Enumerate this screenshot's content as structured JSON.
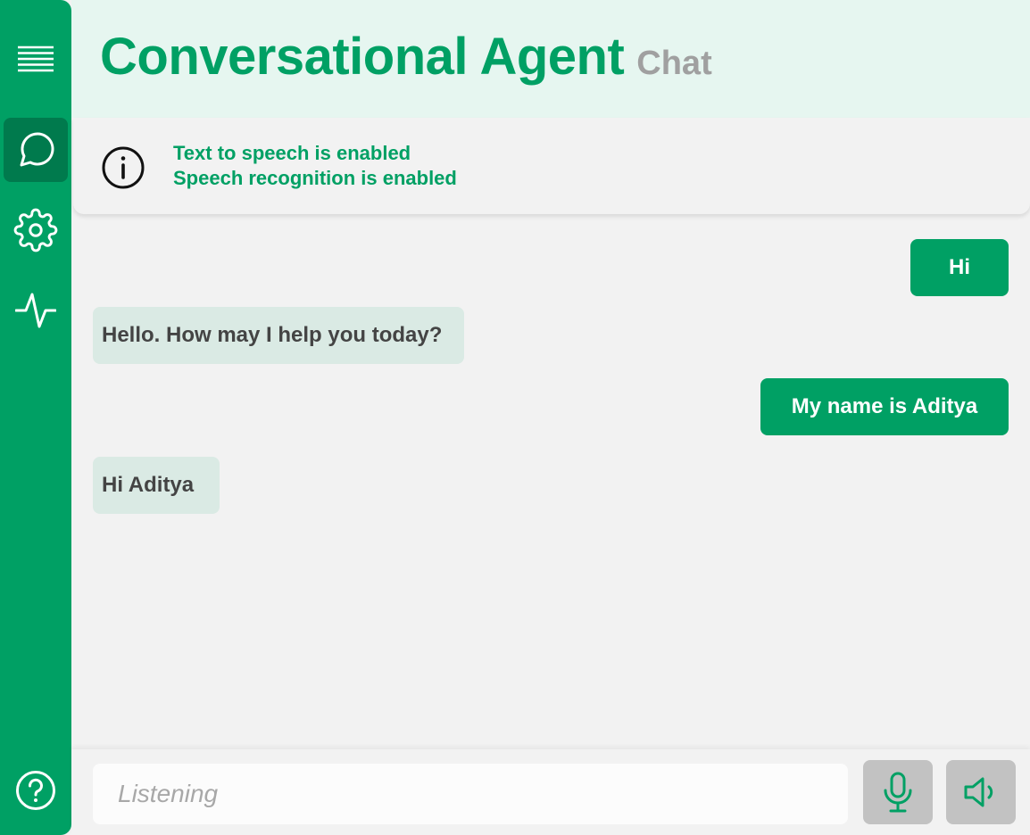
{
  "sidebar": {
    "items": [
      {
        "icon": "menu-icon"
      },
      {
        "icon": "chat-bubble-icon",
        "active": true
      },
      {
        "icon": "gear-icon"
      },
      {
        "icon": "activity-pulse-icon"
      }
    ],
    "help_icon": "help-icon"
  },
  "header": {
    "title": "Conversational Agent",
    "subtitle": "Chat"
  },
  "status_banner": {
    "icon": "info-icon",
    "lines": [
      "Text to speech is enabled",
      "Speech recognition is enabled"
    ]
  },
  "messages": [
    {
      "sender": "user",
      "text": "Hi"
    },
    {
      "sender": "agent",
      "text": "Hello. How may I help you today?"
    },
    {
      "sender": "user",
      "text": "My name is Aditya"
    },
    {
      "sender": "agent",
      "text": "Hi Aditya"
    }
  ],
  "footer": {
    "input_placeholder": "Listening",
    "input_value": "",
    "mic_icon": "microphone-icon",
    "speaker_icon": "speaker-icon"
  },
  "colors": {
    "brand": "#00a064",
    "brand_dark": "#007a4d",
    "header_bg": "#e6f6f0",
    "agent_bubble": "#daeae4",
    "button_bg": "#c2c2c2"
  }
}
